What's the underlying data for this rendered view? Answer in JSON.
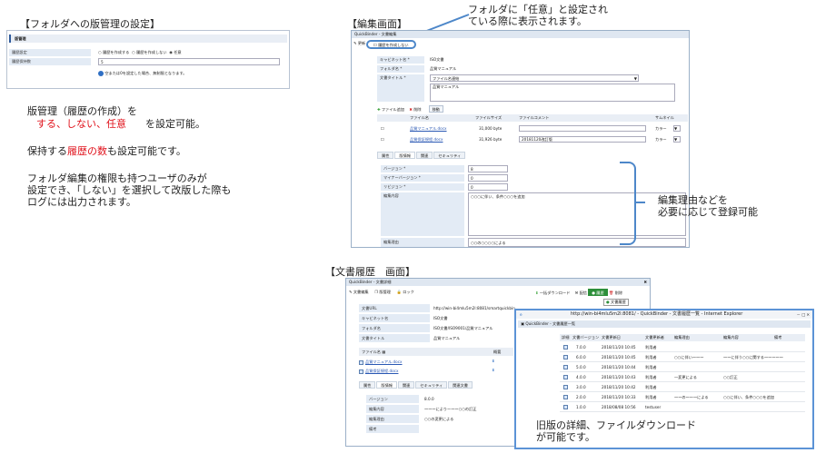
{
  "left": {
    "heading": "【フォルダへの版管理の設定】",
    "settings_panel": {
      "section_title": "版管理",
      "row1_label": "履歴設定",
      "options": [
        "履歴を作成する",
        "履歴を作成しない",
        "任意"
      ],
      "row2_label": "履歴保持数",
      "row2_value": "5",
      "info_text": "空または0を設定した場合、無制限となります。"
    },
    "desc1_line1": "版管理（履歴の作成）を",
    "desc1_red": "する、しない、任意",
    "desc1_tail": "を設定可能。",
    "desc2_lead": "保持する",
    "desc2_red": "履歴の数",
    "desc2_tail": "も設定可能です。",
    "desc3_lines": [
      "フォルダ編集の権限も持つユーザのみが",
      "設定でき、「しない」を選択して改版した際も",
      "ログには出力されます。"
    ]
  },
  "edit_screen": {
    "heading": "【編集画面】",
    "callout_top_line1": "フォルダに「任意」と設定され",
    "callout_top_line2": "ている際に表示されます。",
    "callout_right_line1": "編集理由などを",
    "callout_right_line2": "必要に応じて登録可能",
    "window_title": "QuickBinder - 文書編集",
    "toolbar_save": "更新",
    "toolbar_checkbox": "履歴を作成しない",
    "fields": [
      {
        "label": "キャビネット名 *",
        "value": "ISO文書"
      },
      {
        "label": "フォルダ名 *",
        "value": "品質マニュアル"
      },
      {
        "label": "文書タイトル *",
        "value": "ファイル名連結",
        "value2": "品質マニュアル"
      }
    ],
    "file_buttons": [
      "ファイル追加",
      "削除",
      "移動"
    ],
    "file_cols": [
      "ファイル名",
      "ファイルサイズ",
      "ファイルコメント",
      "サムネイル"
    ],
    "files": [
      {
        "name": "品質マニュアル.docx",
        "size": "31,000 byte",
        "comment": "",
        "thumb": "カラー"
      },
      {
        "name": "品質保証規程.docx",
        "size": "31,926 byte",
        "comment": "20181120改訂版",
        "thumb": "カラー"
      }
    ],
    "tabs": [
      "属性",
      "版情報",
      "関連",
      "セキュリティ"
    ],
    "version_fields": [
      {
        "label": "バージョン *",
        "value": "8"
      },
      {
        "label": "マイナーバージョン *",
        "value": "0"
      },
      {
        "label": "リビジョン *",
        "value": "0"
      },
      {
        "label": "編集内容",
        "value": "○○○に伴い、条件○○○を追加"
      },
      {
        "label": "編集理由",
        "value": "○○の○○○○による"
      }
    ]
  },
  "history_screen": {
    "heading": "【文書履歴　画面】",
    "window_title": "QuickBinder - 文書詳細",
    "toolbar": [
      "文書編集",
      "版管理",
      "ロック"
    ],
    "toolbar_right": [
      "一括ダウンロード",
      "配信",
      "履歴",
      "削除"
    ],
    "history_tooltip": "文書履歴",
    "fields": [
      {
        "label": "文書URL",
        "value": "http://win-bi4mlu5m2l:8081/smartquickbinder/document/detail/.."
      },
      {
        "label": "キャビネット名",
        "value": "ISO文書"
      },
      {
        "label": "フォルダ名",
        "value": "ISO文書/ISO9001/品質マニュアル"
      },
      {
        "label": "文書タイトル",
        "value": "品質マニュアル"
      }
    ],
    "files_header": "ファイル名",
    "files_col": "概要",
    "files": [
      "品質マニュアル.docx",
      "品質保証規程.docx"
    ],
    "tabs": [
      "属性",
      "版情報",
      "関連",
      "セキュリティ",
      "関連文書"
    ],
    "version_rows": [
      {
        "label": "バージョン",
        "value": "8.0.0"
      },
      {
        "label": "編集内容",
        "value": "～～～によりー～～○○の訂正"
      },
      {
        "label": "編集理由",
        "value": "○○の変更による"
      },
      {
        "label": "備考",
        "value": ""
      }
    ],
    "popup": {
      "ie_title": "http://win-bi4mlu5m2l:8081/ - QuickBinder - 文書履歴一覧 - Internet Explorer",
      "inner_title": "QuickBinder - 文書履歴一覧",
      "columns": [
        "詳細",
        "文書バージョン",
        "文書更新日",
        "文書更新者",
        "編集理由",
        "編集内容",
        "備考"
      ],
      "rows": [
        {
          "ver": "7.0.0",
          "date": "2018/11/20 10:45",
          "user": "利用者",
          "reason": "",
          "content": ""
        },
        {
          "ver": "6.0.0",
          "date": "2018/11/20 10:45",
          "user": "利用者",
          "reason": "○○に伴い～～～",
          "content": "～～に伴う○○に関する～～～～～"
        },
        {
          "ver": "5.0.0",
          "date": "2018/11/20 10:44",
          "user": "利用者",
          "reason": "",
          "content": ""
        },
        {
          "ver": "4.0.0",
          "date": "2018/11/20 10:43",
          "user": "利用者",
          "reason": "一変更による",
          "content": "○○訂正"
        },
        {
          "ver": "3.0.0",
          "date": "2018/11/20 10:42",
          "user": "利用者",
          "reason": "",
          "content": ""
        },
        {
          "ver": "2.0.0",
          "date": "2018/11/20 10:33",
          "user": "利用者",
          "reason": "～～の～～～による",
          "content": "○○に伴い、条件○○○を追加"
        },
        {
          "ver": "1.0.0",
          "date": "2018/08/08 10:56",
          "user": "testuser",
          "reason": "",
          "content": ""
        }
      ]
    },
    "callout_line1": "旧版の詳細、ファイルダウンロード",
    "callout_line2": "が可能です。"
  }
}
